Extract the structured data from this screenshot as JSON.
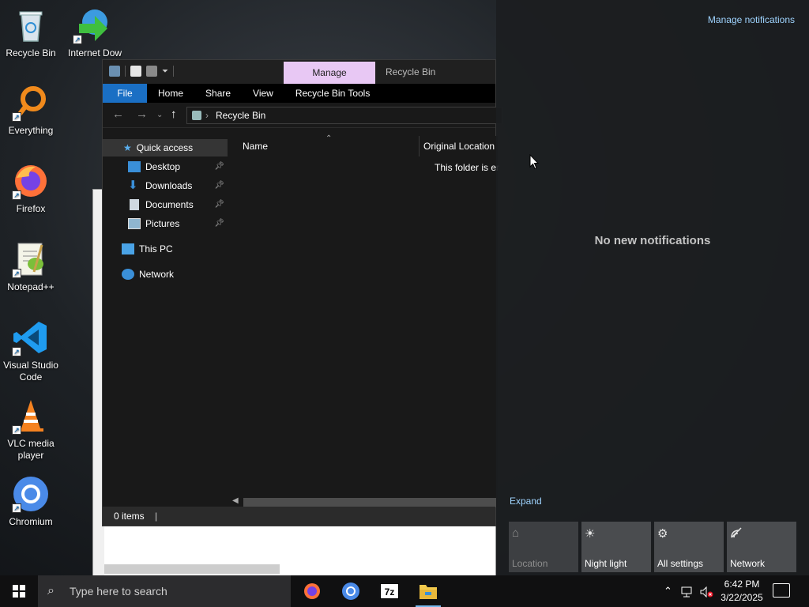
{
  "desktop": {
    "icons": [
      {
        "label": "Recycle Bin"
      },
      {
        "label": "Internet Downlo"
      },
      {
        "label": "Everything"
      },
      {
        "label": "Firefox"
      },
      {
        "label": "Notepad++"
      },
      {
        "label": "Visual Studio Code"
      },
      {
        "label": "VLC media player"
      },
      {
        "label": "Chromium"
      }
    ]
  },
  "explorer": {
    "title": "Recycle Bin",
    "manage_tab": "Manage",
    "ribbon_tabs": [
      "File",
      "Home",
      "Share",
      "View",
      "Recycle Bin Tools"
    ],
    "address": "Recycle Bin",
    "nav": {
      "quick_access": "Quick access",
      "items": [
        "Desktop",
        "Downloads",
        "Documents",
        "Pictures"
      ],
      "this_pc": "This PC",
      "network": "Network"
    },
    "columns": [
      "Name",
      "Original Location"
    ],
    "empty_message": "This folder is er",
    "status": "0 items"
  },
  "action_center": {
    "manage_notifications": "Manage notifications",
    "empty_text": "No new notifications",
    "expand": "Expand",
    "quick_actions": [
      {
        "label": "Location",
        "icon": "location-icon",
        "enabled": false
      },
      {
        "label": "Night light",
        "icon": "brightness-icon",
        "enabled": true
      },
      {
        "label": "All settings",
        "icon": "gear-icon",
        "enabled": true
      },
      {
        "label": "Network",
        "icon": "network-icon",
        "enabled": true
      }
    ]
  },
  "taskbar": {
    "search_placeholder": "Type here to search",
    "apps": [
      "Firefox",
      "Chromium",
      "7-Zip",
      "File Explorer"
    ],
    "time": "6:42 PM",
    "date": "3/22/2025"
  },
  "colors": {
    "accent": "#1a6fc4",
    "manage_tab": "#e8c8f4",
    "link": "#9fd4ff"
  }
}
